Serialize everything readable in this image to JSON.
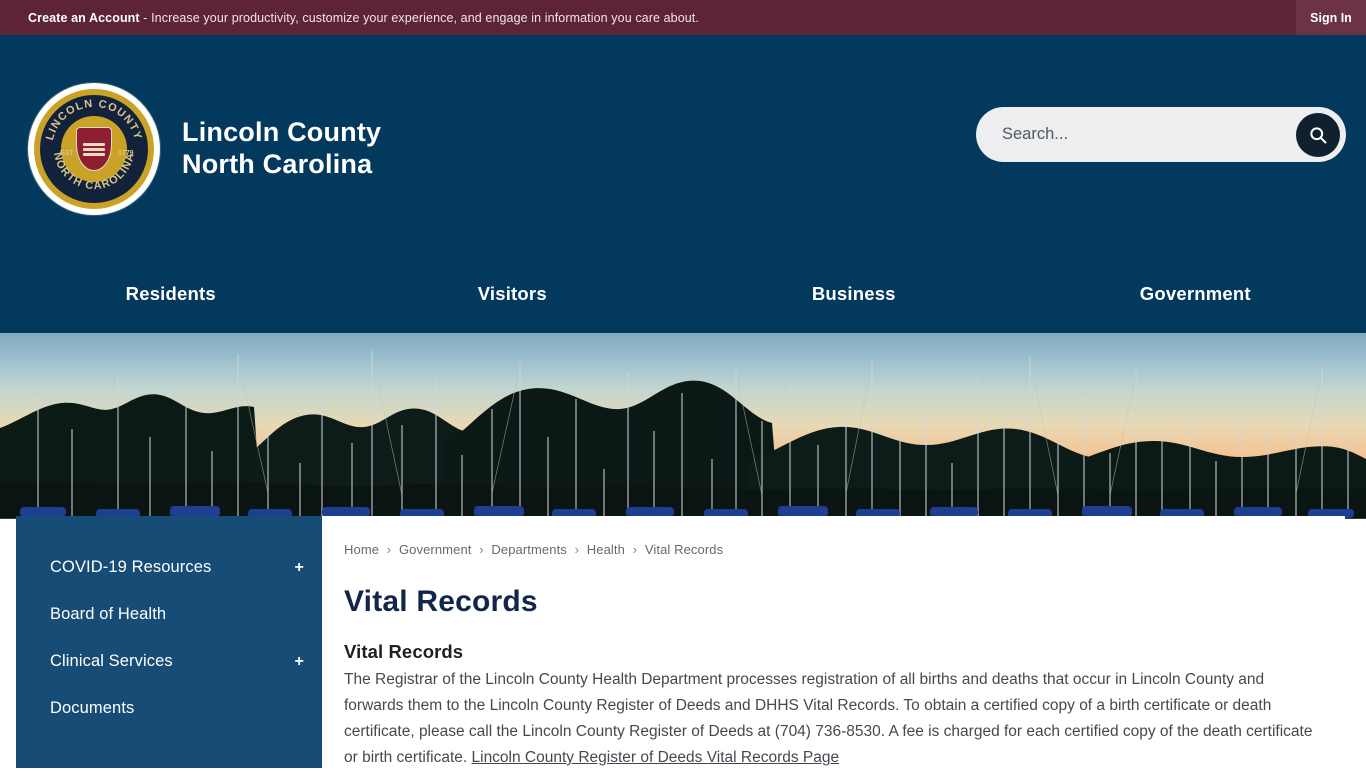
{
  "topbar": {
    "cta_bold": "Create an Account",
    "message": " - Increase your productivity, customize your experience, and engage in information you care about.",
    "signin_label": "Sign In"
  },
  "header": {
    "seal": {
      "top_text": "LINCOLN COUNTY",
      "bottom_text": "NORTH CAROLINA",
      "est_label": "EST",
      "est_year": "1779"
    },
    "brand_line1": "Lincoln County",
    "brand_line2": "North Carolina",
    "search": {
      "placeholder": "Search...",
      "value": "",
      "icon": "search-icon"
    },
    "nav": [
      {
        "label": "Residents"
      },
      {
        "label": "Visitors"
      },
      {
        "label": "Business"
      },
      {
        "label": "Government"
      }
    ]
  },
  "hero": {
    "alt": "marina-sunset-sailboats-banner"
  },
  "sidebar": {
    "items": [
      {
        "label": "COVID-19 Resources",
        "expander": "+"
      },
      {
        "label": "Board of Health",
        "expander": ""
      },
      {
        "label": "Clinical Services",
        "expander": "+"
      },
      {
        "label": "Documents",
        "expander": ""
      }
    ]
  },
  "main": {
    "breadcrumb": [
      "Home",
      "Government",
      "Departments",
      "Health",
      "Vital Records"
    ],
    "breadcrumb_separator": "›",
    "page_title": "Vital Records",
    "section_title": "Vital Records",
    "body_before_link": "The Registrar of the Lincoln County Health Department processes registration of all births and deaths that occur in Lincoln County and forwards them to the Lincoln County Register of Deeds and DHHS Vital Records. To obtain a certified copy of a birth certificate or death certificate, please call the Lincoln County Register of Deeds at (704) 736-8530. A fee is charged for each certified copy of the death certificate or birth certificate. ",
    "body_link": "Lincoln County Register of Deeds Vital Records Page"
  },
  "colors": {
    "topbar_maroon": "#5c2435",
    "signin_maroon": "#6b3344",
    "header_blue": "#04395e",
    "sidebar_blue": "#174c76",
    "title_navy": "#12264a",
    "body_gray": "#4a4650",
    "seal_gold": "#c9a227",
    "seal_navy": "#12223a",
    "crest_red": "#8e1f33"
  }
}
